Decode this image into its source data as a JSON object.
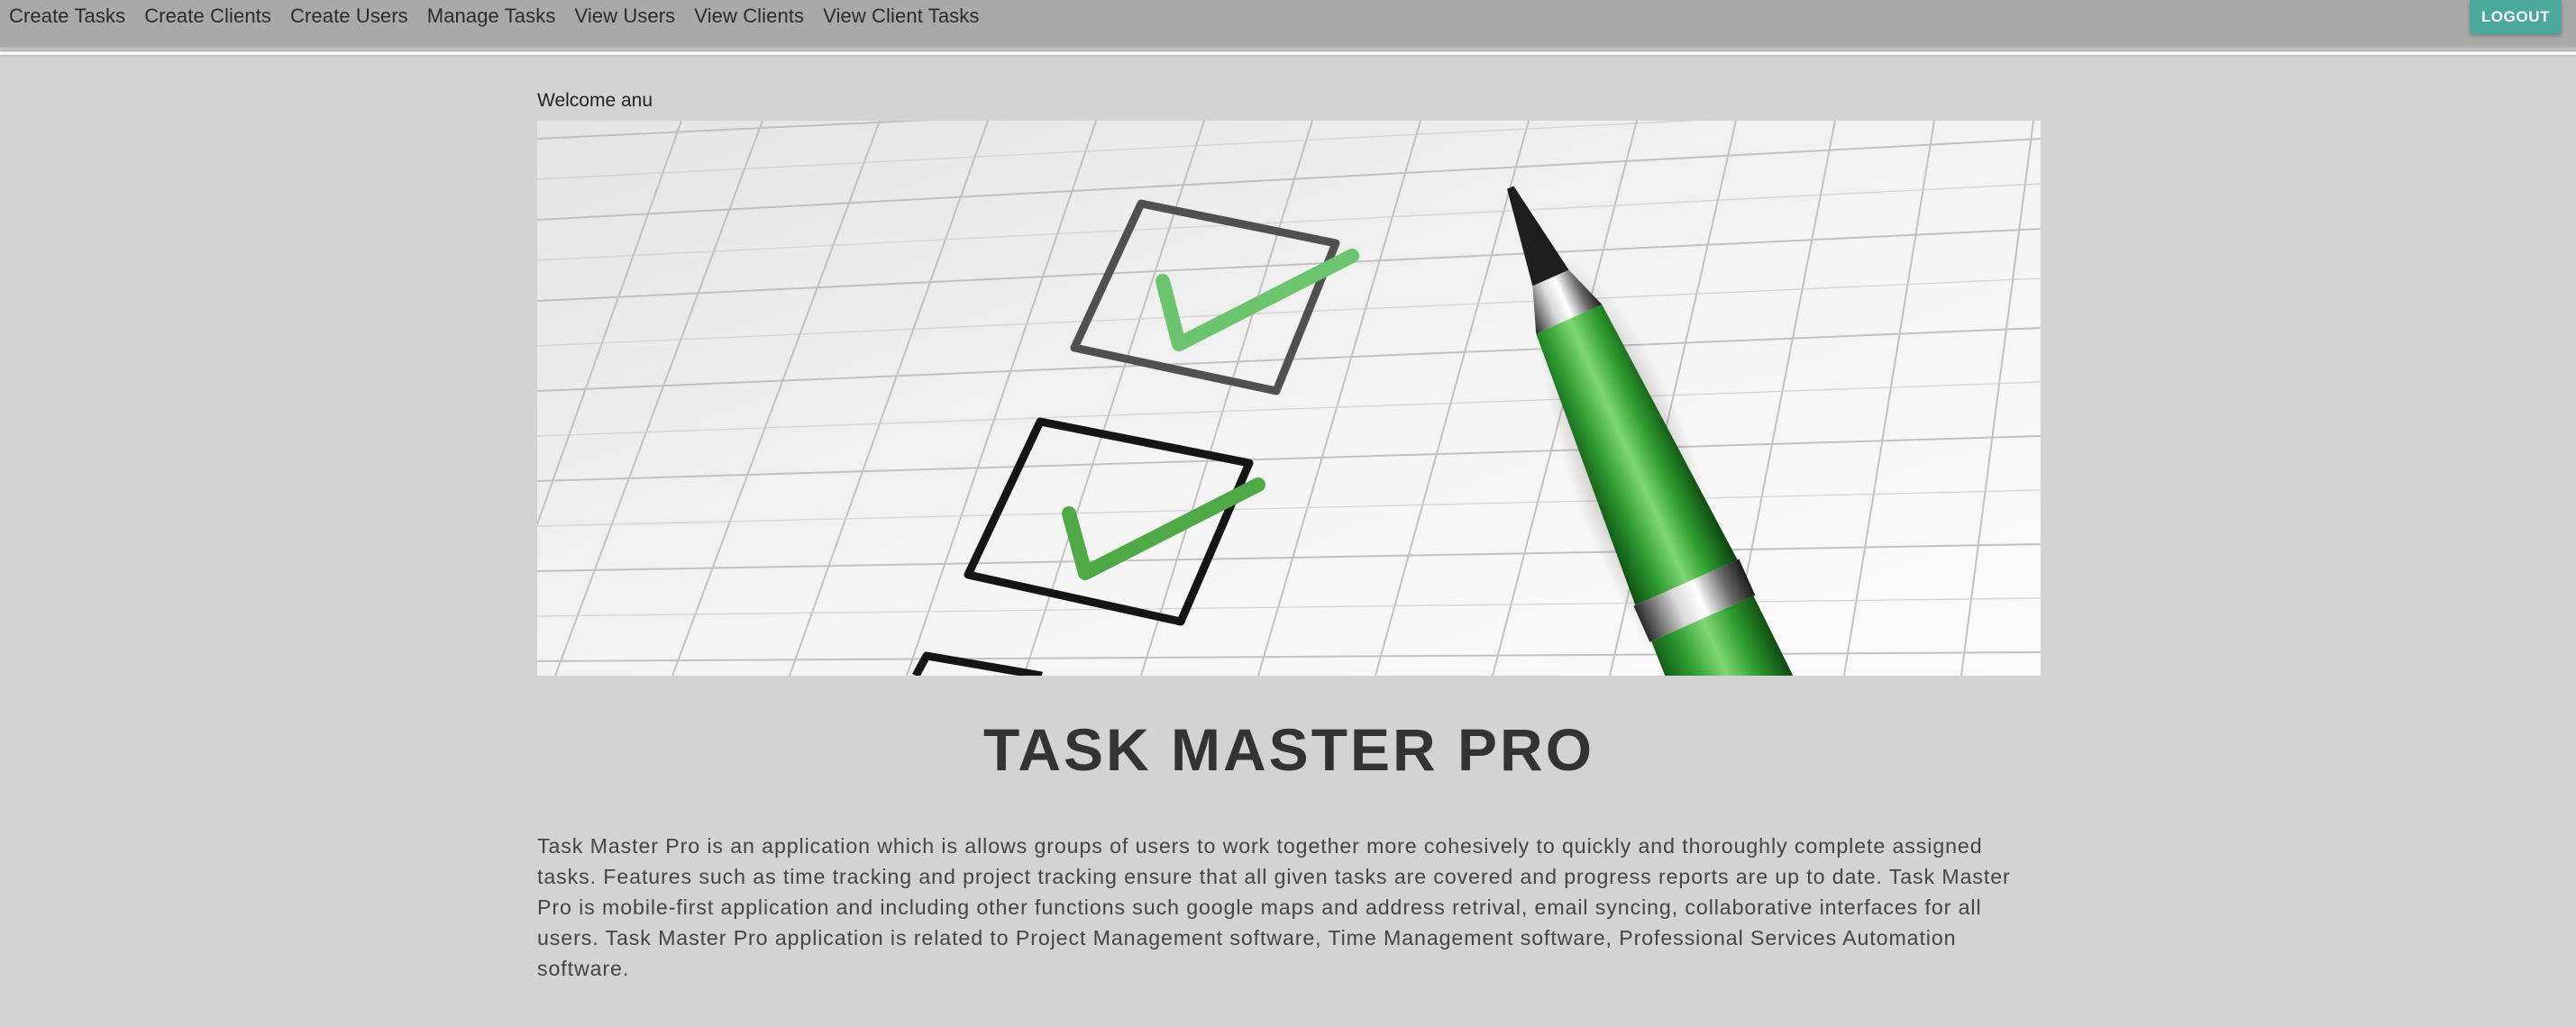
{
  "nav": {
    "links": [
      {
        "label": "Create Tasks"
      },
      {
        "label": "Create Clients"
      },
      {
        "label": "Create Users"
      },
      {
        "label": "Manage Tasks"
      },
      {
        "label": "View Users"
      },
      {
        "label": "View Clients"
      },
      {
        "label": "View Client Tasks"
      }
    ],
    "logout_label": "LOGOUT"
  },
  "main": {
    "welcome": "Welcome anu",
    "hero_image": "checklist-with-green-pen",
    "title": "TASK MASTER PRO",
    "description": "Task Master Pro is an application which is allows groups of users to work together more cohesively to quickly and thoroughly complete assigned tasks. Features such as time tracking and project tracking ensure that all given tasks are covered and progress reports are up to date. Task Master Pro is mobile-first application and including other functions such google maps and address retrival, email syncing, collaborative interfaces for all users. Task Master Pro application is related to Project Management software, Time Management software, Professional Services Automation software."
  },
  "colors": {
    "page_background": "#d3d3d3",
    "navbar_background": "#a9a9a9",
    "logout_button": "#4aa99b",
    "check_green": "#5cb85c"
  }
}
